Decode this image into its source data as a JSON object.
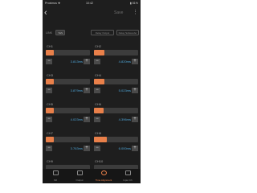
{
  "status_bar": {
    "carrier": "Proximus ❖",
    "time": "10:42",
    "battery": "▮ 51%"
  },
  "header": {
    "back_icon": "chevron-left-icon",
    "save_label": "Save",
    "more_icon": "more-vertical-icon"
  },
  "link": {
    "label": "LINK",
    "value": "YES",
    "button_a": "Delay Output",
    "button_b": "Delay Subwoofer"
  },
  "accent_color": "#e9804a",
  "value_color": "#4fa6d8",
  "channels": [
    {
      "label": "CH1",
      "value": "3.813ms",
      "level": 0.18
    },
    {
      "label": "CH2",
      "value": "4.820ms",
      "level": 0.23
    },
    {
      "label": "CH3",
      "value": "3.879ms",
      "level": 0.19
    },
    {
      "label": "CH4",
      "value": "5.023ms",
      "level": 0.24
    },
    {
      "label": "CH5",
      "value": "4.023ms",
      "level": 0.19
    },
    {
      "label": "CH6",
      "value": "4.396ms",
      "level": 0.21
    },
    {
      "label": "CH7",
      "value": "3.763ms",
      "level": 0.18
    },
    {
      "label": "CH8",
      "value": "6.000ms",
      "level": 0.29
    },
    {
      "label": "CH9",
      "value": "",
      "level": 0
    },
    {
      "label": "CH10",
      "value": "",
      "level": 0
    }
  ],
  "tabs": [
    {
      "label": "SR",
      "icon": "speaker-icon"
    },
    {
      "label": "Output",
      "icon": "grid-icon"
    },
    {
      "label": "Time Alignment",
      "icon": "clock-icon"
    },
    {
      "label": "Input Ch",
      "icon": "input-icon"
    }
  ],
  "active_tab": "Time Alignment"
}
